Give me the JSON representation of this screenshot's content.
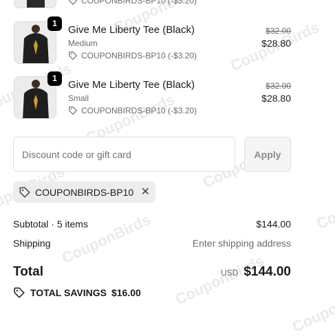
{
  "watermark": "CouponBirds",
  "top_partial": {
    "discount_text": "COUPONBIRDS-BP10 (-$3.20)"
  },
  "items": [
    {
      "qty": "1",
      "name": "Give Me Liberty Tee (Black)",
      "variant": "Medium",
      "discount": "COUPONBIRDS-BP10 (-$3.20)",
      "original_price": "$32.00",
      "price": "$28.80"
    },
    {
      "qty": "1",
      "name": "Give Me Liberty Tee (Black)",
      "variant": "Small",
      "discount": "COUPONBIRDS-BP10 (-$3.20)",
      "original_price": "$32.00",
      "price": "$28.80"
    }
  ],
  "discount": {
    "placeholder": "Discount code or gift card",
    "apply_label": "Apply"
  },
  "applied_code": "COUPONBIRDS-BP10",
  "summary": {
    "subtotal_label": "Subtotal · 5 items",
    "subtotal_value": "$144.00",
    "shipping_label": "Shipping",
    "shipping_value": "Enter shipping address",
    "total_label": "Total",
    "currency": "USD",
    "total_value": "$144.00",
    "savings_label": "TOTAL SAVINGS",
    "savings_value": "$16.00"
  },
  "colors": {
    "accent_text": "#1a1a1a",
    "muted": "#6b6b6b",
    "badge": "#000000",
    "chip_bg": "#ededed"
  }
}
